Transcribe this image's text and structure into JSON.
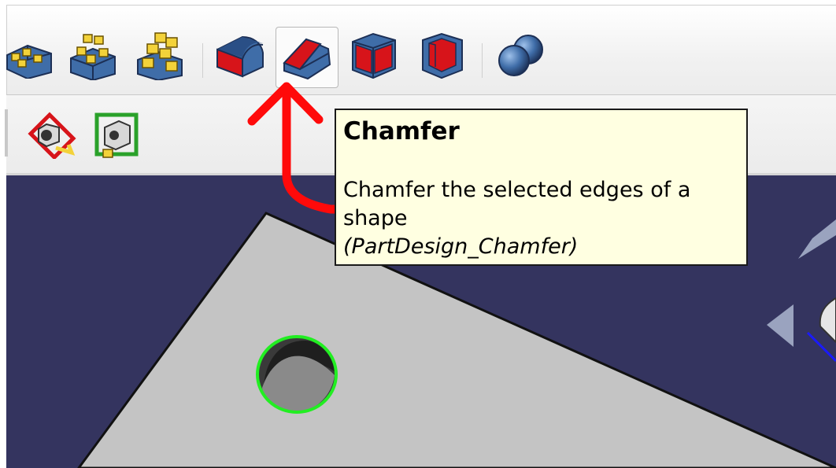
{
  "toolbar": {
    "row1": [
      {
        "name": "multitransform-partial-icon"
      },
      {
        "name": "polar-pattern-icon"
      },
      {
        "name": "multitransform-icon"
      },
      {
        "name": "fillet-icon"
      },
      {
        "name": "chamfer-icon",
        "active": true
      },
      {
        "name": "draft-icon"
      },
      {
        "name": "thickness-icon"
      },
      {
        "name": "boolean-icon"
      }
    ],
    "row2": [
      {
        "name": "sketch-tool-icon"
      },
      {
        "name": "validate-sketch-icon"
      }
    ]
  },
  "tooltip": {
    "title": "Chamfer",
    "description": "Chamfer the selected edges of a shape",
    "command": "(PartDesign_Chamfer)"
  },
  "colors": {
    "viewport_background": "#34345f",
    "tooltip_background": "#ffffe1",
    "annotation_red": "#ff0a0a",
    "selection_green": "#22ee22",
    "part_face": "#c4c4c4"
  }
}
